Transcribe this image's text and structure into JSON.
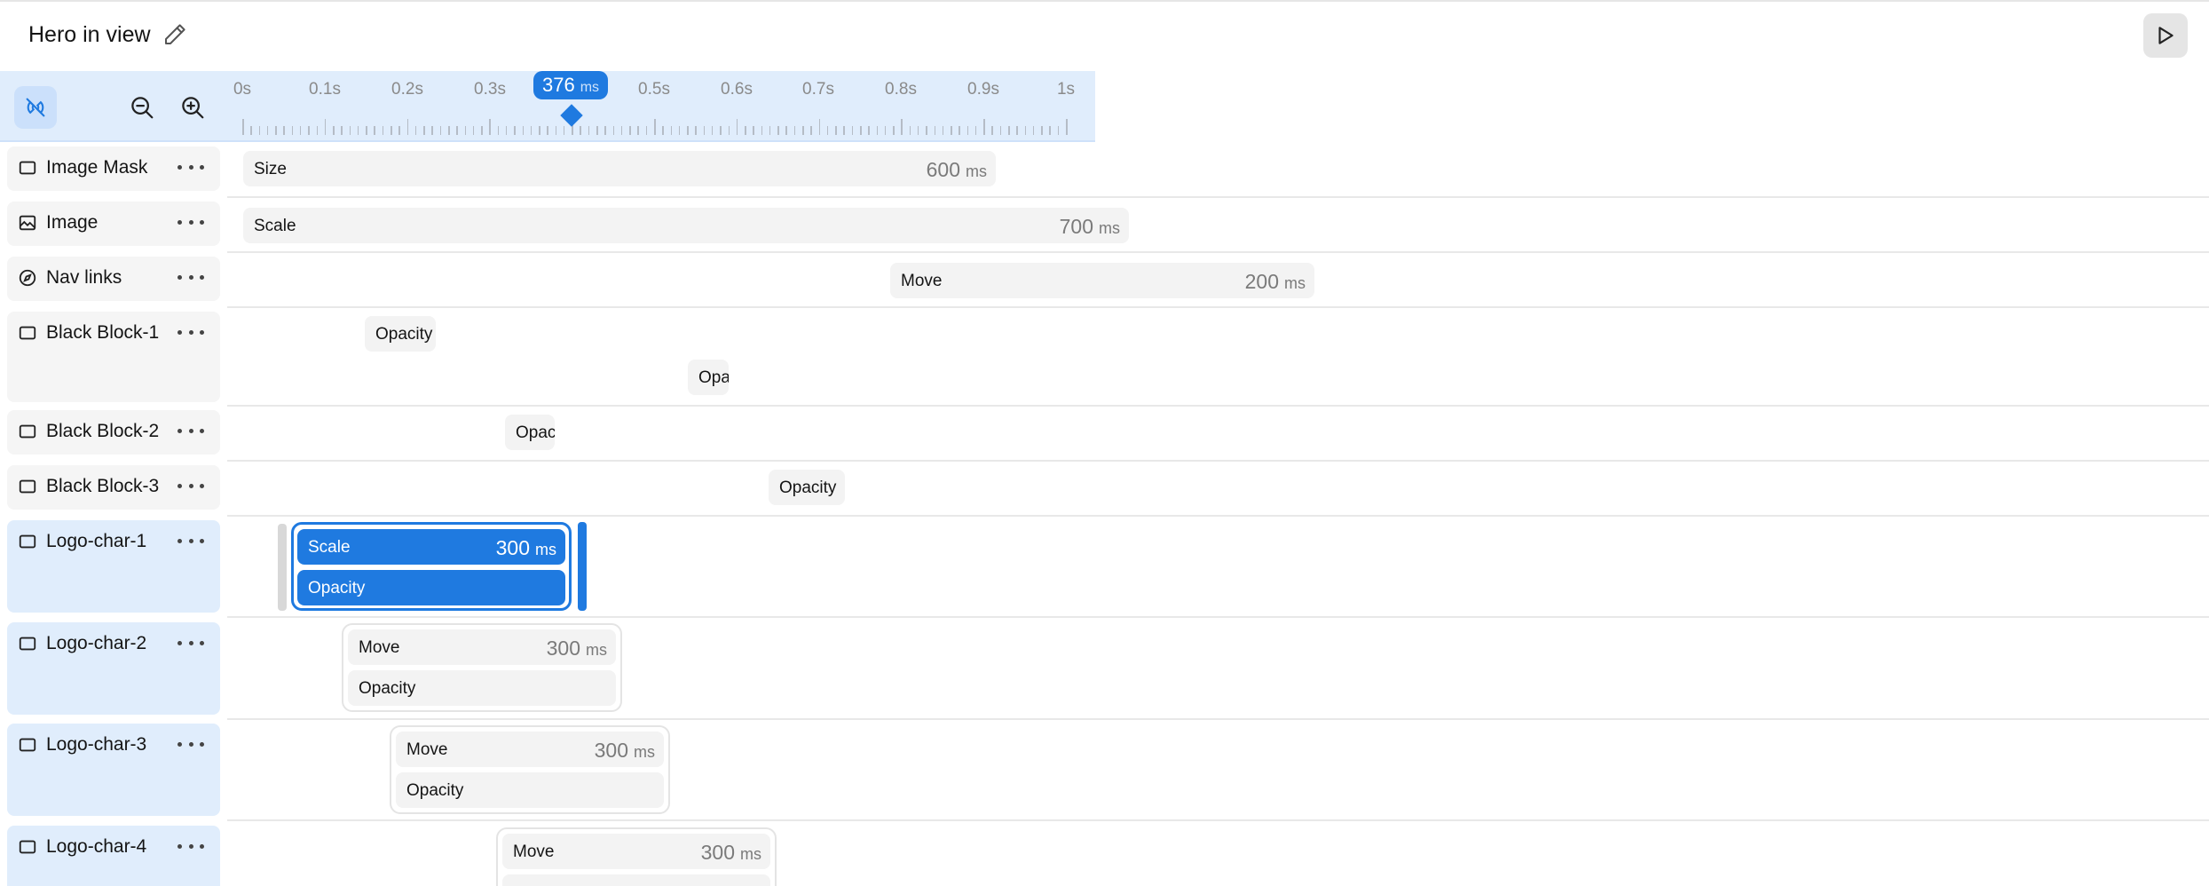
{
  "header": {
    "title": "Hero in view",
    "edit_icon": "pencil-icon",
    "play_icon": "play-icon"
  },
  "toolbar": {
    "buttons": [
      {
        "name": "magnet-off-icon",
        "active": true
      },
      {
        "name": "zoom-out-icon"
      },
      {
        "name": "zoom-in-icon"
      }
    ],
    "ticks": [
      "0s",
      "0.1s",
      "0.2s",
      "0.3s",
      "0.5s",
      "0.6s",
      "0.7s",
      "0.8s",
      "0.9s",
      "1s"
    ],
    "playhead": {
      "value": "376",
      "unit": "ms"
    }
  },
  "layers": [
    {
      "name": "Image Mask",
      "icon": "square-icon"
    },
    {
      "name": "Image",
      "icon": "image-icon"
    },
    {
      "name": "Nav links",
      "icon": "compass-icon"
    },
    {
      "name": "Black Block-1",
      "icon": "square-icon"
    },
    {
      "name": "Black Block-2",
      "icon": "square-icon"
    },
    {
      "name": "Black Block-3",
      "icon": "square-icon"
    },
    {
      "name": "Logo-char-1",
      "icon": "square-icon",
      "selected": true
    },
    {
      "name": "Logo-char-2",
      "icon": "square-icon",
      "selected": true
    },
    {
      "name": "Logo-char-3",
      "icon": "square-icon",
      "selected": true
    },
    {
      "name": "Logo-char-4",
      "icon": "square-icon",
      "selected": true
    }
  ],
  "tracks": {
    "image_mask": {
      "label": "Size",
      "duration": "600",
      "unit": "ms"
    },
    "image": {
      "label": "Scale",
      "duration": "700",
      "unit": "ms"
    },
    "nav_links": {
      "label": "Move",
      "duration": "200",
      "unit": "ms"
    },
    "black_block_1": [
      {
        "label": "Opacity"
      },
      {
        "label": "Opa"
      }
    ],
    "black_block_2": {
      "label": "Opac"
    },
    "black_block_3": {
      "label": "Opacity"
    },
    "logo_char_1": [
      {
        "label": "Scale",
        "duration": "300",
        "unit": "ms"
      },
      {
        "label": "Opacity"
      }
    ],
    "logo_char_2": [
      {
        "label": "Move",
        "duration": "300",
        "unit": "ms"
      },
      {
        "label": "Opacity"
      }
    ],
    "logo_char_3": [
      {
        "label": "Move",
        "duration": "300",
        "unit": "ms"
      },
      {
        "label": "Opacity"
      }
    ],
    "logo_char_4": [
      {
        "label": "Move",
        "duration": "300",
        "unit": "ms"
      }
    ]
  },
  "colors": {
    "accent": "#1f7ae0",
    "toolbar_bg": "#e0edfc",
    "bar_bg": "#f3f3f3"
  }
}
